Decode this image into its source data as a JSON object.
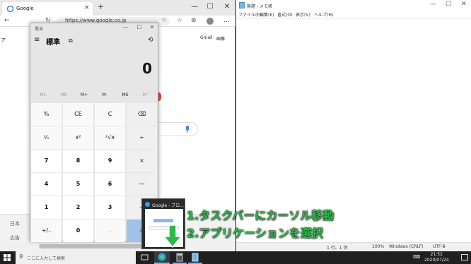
{
  "browser": {
    "tab_title": "Google",
    "close": "×",
    "minimize": "—",
    "maximize": "☐",
    "window_close": "✕",
    "address": "https://www.google.co.jp",
    "gmail": "Gmail",
    "images": "画像",
    "left_cut": "ア",
    "footer_country": "日本",
    "footer_ads": "広告"
  },
  "notepad": {
    "title": "無題 - メモ帳",
    "menu": [
      "ファイル(F)",
      "編集(E)",
      "書式(O)",
      "表示(V)",
      "ヘルプ(H)"
    ],
    "status": {
      "pos": "1 行、1 列",
      "zoom": "100%",
      "eol": "Windows (CRLF)",
      "enc": "UTF-8"
    }
  },
  "calculator": {
    "title": "電卓",
    "mode": "標準",
    "display": "0",
    "memory": [
      "MC",
      "MR",
      "M+",
      "M-",
      "MS",
      "M˅"
    ],
    "keys": [
      [
        "%",
        "CE",
        "C",
        "⌫"
      ],
      [
        "¹⁄ₓ",
        "x²",
        "²√x",
        "÷"
      ],
      [
        "7",
        "8",
        "9",
        "×"
      ],
      [
        "4",
        "5",
        "6",
        "—"
      ],
      [
        "1",
        "2",
        "3",
        "+"
      ],
      [
        "+/₋",
        "0",
        ".",
        "="
      ]
    ]
  },
  "thumbnail": {
    "title": "Google - ブロ..."
  },
  "annotation": {
    "line1": "1.タスクバーにカーソル移動",
    "line2": "2.アプリケーションを選択"
  },
  "taskbar": {
    "search_placeholder": "ここに入力して検索",
    "time": "21:52",
    "date": "2020/07/24"
  },
  "colors": {
    "annotation": "#2eb84a",
    "calc_equals": "#9fc3e6"
  }
}
